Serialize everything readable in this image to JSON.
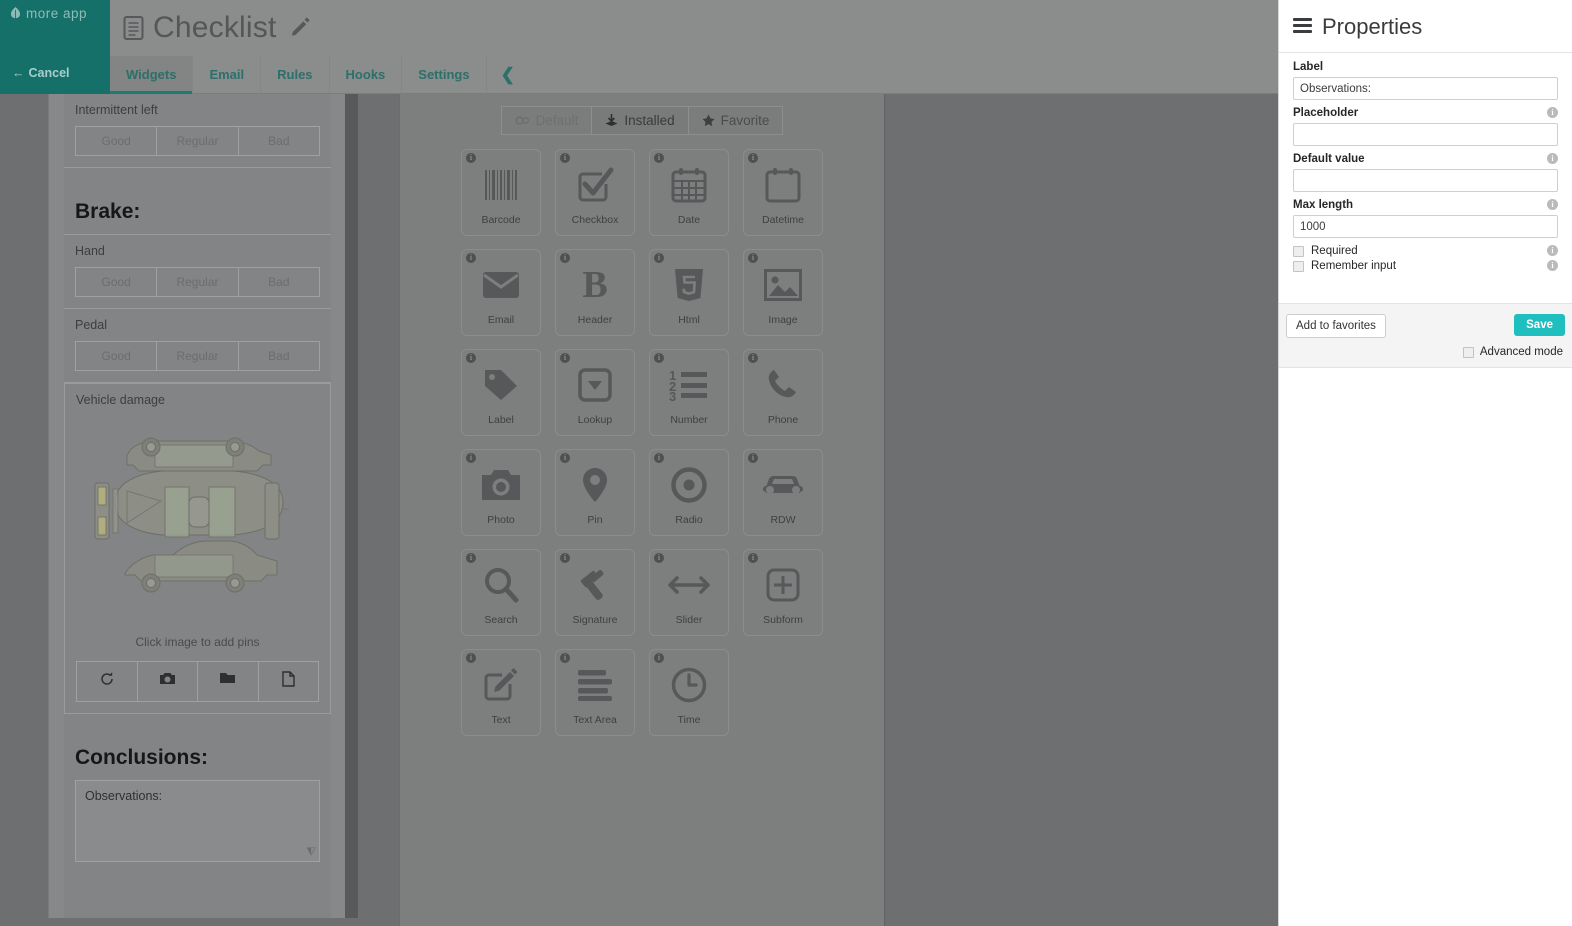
{
  "brand": {
    "name": "more app",
    "logo_icon": "leaf-icon"
  },
  "nav": {
    "cancel_label": "Cancel",
    "back_arrow": "←",
    "title": "Checklist",
    "title_icon": "document-icon",
    "edit_icon": "pencil-icon",
    "tabs": [
      {
        "label": "Widgets",
        "active": true
      },
      {
        "label": "Email",
        "active": false
      },
      {
        "label": "Rules",
        "active": false
      },
      {
        "label": "Hooks",
        "active": false
      },
      {
        "label": "Settings",
        "active": false
      }
    ],
    "collapse_icon": "❮"
  },
  "form_preview": {
    "fields": [
      {
        "type": "radio",
        "label": "Intermittent left",
        "options": [
          "Good",
          "Regular",
          "Bad"
        ]
      }
    ],
    "brake_heading": "Brake:",
    "brake_fields": [
      {
        "type": "radio",
        "label": "Hand",
        "options": [
          "Good",
          "Regular",
          "Bad"
        ]
      },
      {
        "type": "radio",
        "label": "Pedal",
        "options": [
          "Good",
          "Regular",
          "Bad"
        ]
      }
    ],
    "image_field": {
      "label": "Vehicle damage",
      "hint": "Click image to add pins",
      "buttons": [
        "rotate-icon",
        "camera-icon",
        "folder-icon",
        "file-icon"
      ]
    },
    "conclusions_heading": "Conclusions:",
    "textarea": {
      "value": "Observations:",
      "resize_grip": "⧨"
    }
  },
  "palette": {
    "filters": [
      {
        "label": "Default",
        "icon": "gears-icon",
        "state": "muted"
      },
      {
        "label": "Installed",
        "icon": "download-icon",
        "state": "active"
      },
      {
        "label": "Favorite",
        "icon": "star-icon",
        "state": "normal"
      }
    ],
    "info_badge": "i",
    "widgets": [
      {
        "name": "Barcode",
        "icon": "barcode-icon"
      },
      {
        "name": "Checkbox",
        "icon": "checkbox-icon"
      },
      {
        "name": "Date",
        "icon": "calendar-icon"
      },
      {
        "name": "Datetime",
        "icon": "calendar-blank-icon"
      },
      {
        "name": "Email",
        "icon": "envelope-icon"
      },
      {
        "name": "Header",
        "icon": "bold-b-icon"
      },
      {
        "name": "Html",
        "icon": "html5-icon"
      },
      {
        "name": "Image",
        "icon": "picture-icon"
      },
      {
        "name": "Label",
        "icon": "tag-icon"
      },
      {
        "name": "Lookup",
        "icon": "dropdown-icon"
      },
      {
        "name": "Number",
        "icon": "numbered-list-icon"
      },
      {
        "name": "Phone",
        "icon": "phone-icon"
      },
      {
        "name": "Photo",
        "icon": "camera-icon"
      },
      {
        "name": "Pin",
        "icon": "map-pin-icon"
      },
      {
        "name": "Radio",
        "icon": "radio-icon"
      },
      {
        "name": "RDW",
        "icon": "car-icon"
      },
      {
        "name": "Search",
        "icon": "magnifier-icon"
      },
      {
        "name": "Signature",
        "icon": "gavel-icon"
      },
      {
        "name": "Slider",
        "icon": "arrows-horizontal-icon"
      },
      {
        "name": "Subform",
        "icon": "plus-square-icon"
      },
      {
        "name": "Text",
        "icon": "pencil-square-icon"
      },
      {
        "name": "Text Area",
        "icon": "text-lines-icon"
      },
      {
        "name": "Time",
        "icon": "clock-icon"
      }
    ],
    "annotation": {
      "shape": "circle",
      "color": "#fc2b12",
      "targets": "Text Area"
    }
  },
  "properties": {
    "title": "Properties",
    "menu_icon": "hamburger-icon",
    "fields": [
      {
        "label": "Label",
        "value": "Observations:",
        "placeholder": "",
        "has_info": false
      },
      {
        "label": "Placeholder",
        "value": "",
        "placeholder": "",
        "has_info": true
      },
      {
        "label": "Default value",
        "value": "",
        "placeholder": "",
        "has_info": true
      },
      {
        "label": "Max length",
        "value": "1000",
        "placeholder": "",
        "has_info": true
      }
    ],
    "checkboxes": [
      {
        "label": "Required",
        "checked": false,
        "has_info": true
      },
      {
        "label": "Remember input",
        "checked": false,
        "has_info": true
      }
    ],
    "favorites_button": "Add to favorites",
    "save_button": "Save",
    "advanced_mode": {
      "label": "Advanced mode",
      "checked": false
    },
    "info_badge": "i",
    "accent_color": "#1fbfc0"
  }
}
